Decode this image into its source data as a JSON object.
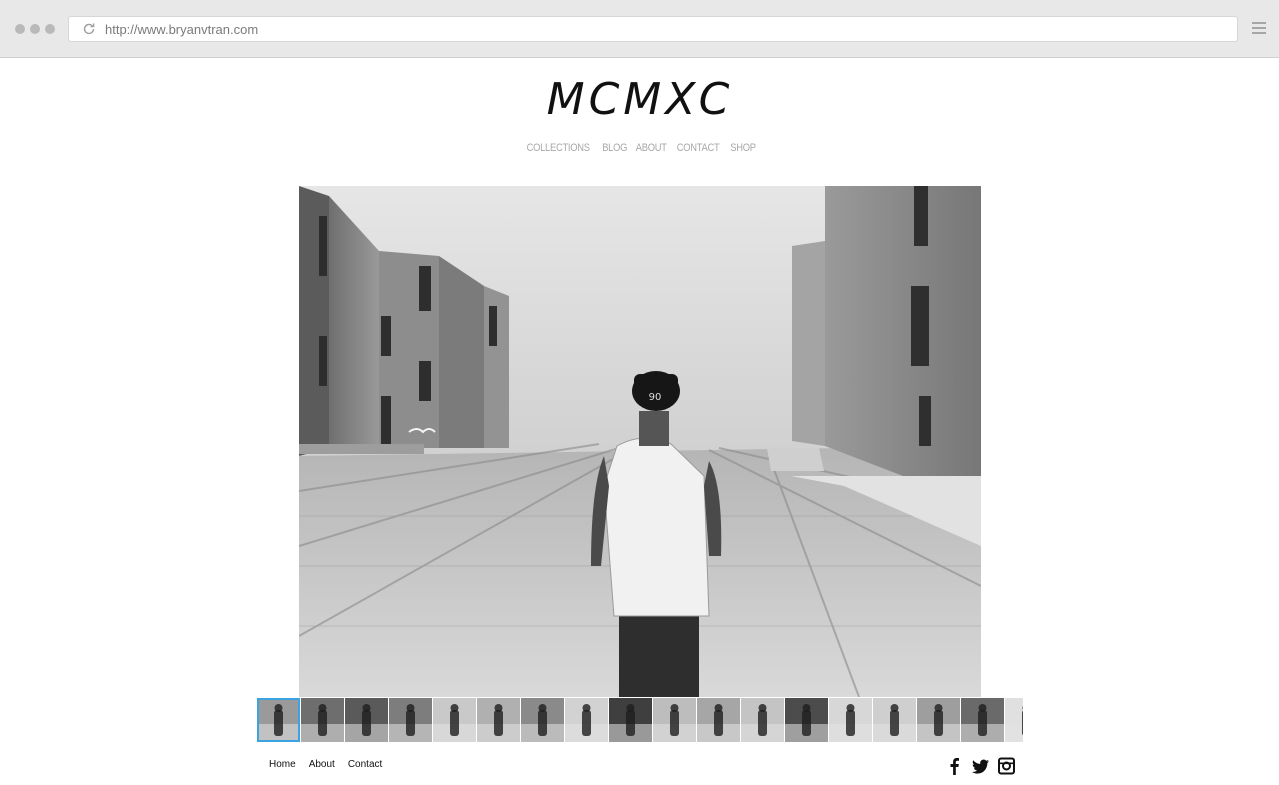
{
  "browser": {
    "url": "http://www.bryanvtran.com"
  },
  "site": {
    "logo": "MCMXC",
    "nav": [
      "COLLECTIONS",
      "BLOG",
      "ABOUT",
      "CONTACT",
      "SHOP"
    ]
  },
  "gallery": {
    "thumbnail_count": 18,
    "active_index": 0
  },
  "footer": {
    "links": [
      "Home",
      "About",
      "Contact"
    ],
    "social_icons": [
      "facebook-icon",
      "twitter-icon",
      "instagram-icon"
    ]
  },
  "colors": {
    "accent": "#3ba3e0",
    "nav_text": "#a8a8a8"
  }
}
